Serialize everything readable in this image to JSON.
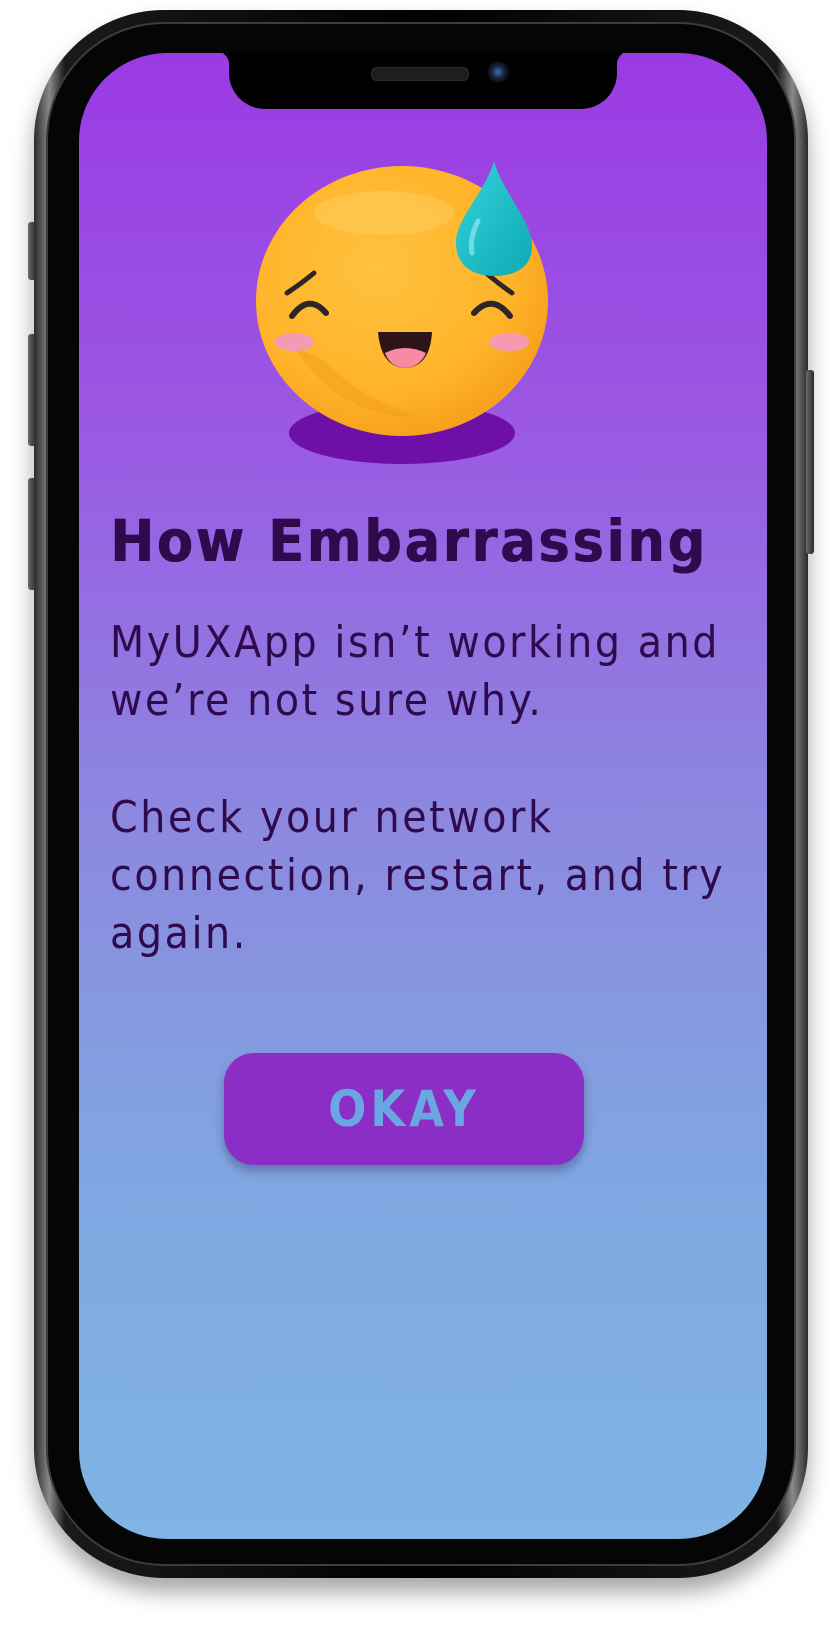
{
  "dialog": {
    "title": "How Embarrassing",
    "message_primary": "MyUXApp isn’t working and we’re not sure why.",
    "message_secondary": "Check your network connection, restart, and try again.",
    "okay_label": "OKAY"
  },
  "illustration": {
    "icon": "sweat-smile-face-icon",
    "colors": {
      "face": "#ffb733",
      "sweat_drop": "#1ec2cc",
      "shadow": "#6e10a8",
      "cheeks": "#f59ab3"
    }
  },
  "colors": {
    "background_top": "#9a3ae4",
    "background_bottom": "#7fb4e4",
    "text": "#2f0a4c",
    "button_fill": "#8a2ec6",
    "button_text": "#6aa6e2"
  }
}
